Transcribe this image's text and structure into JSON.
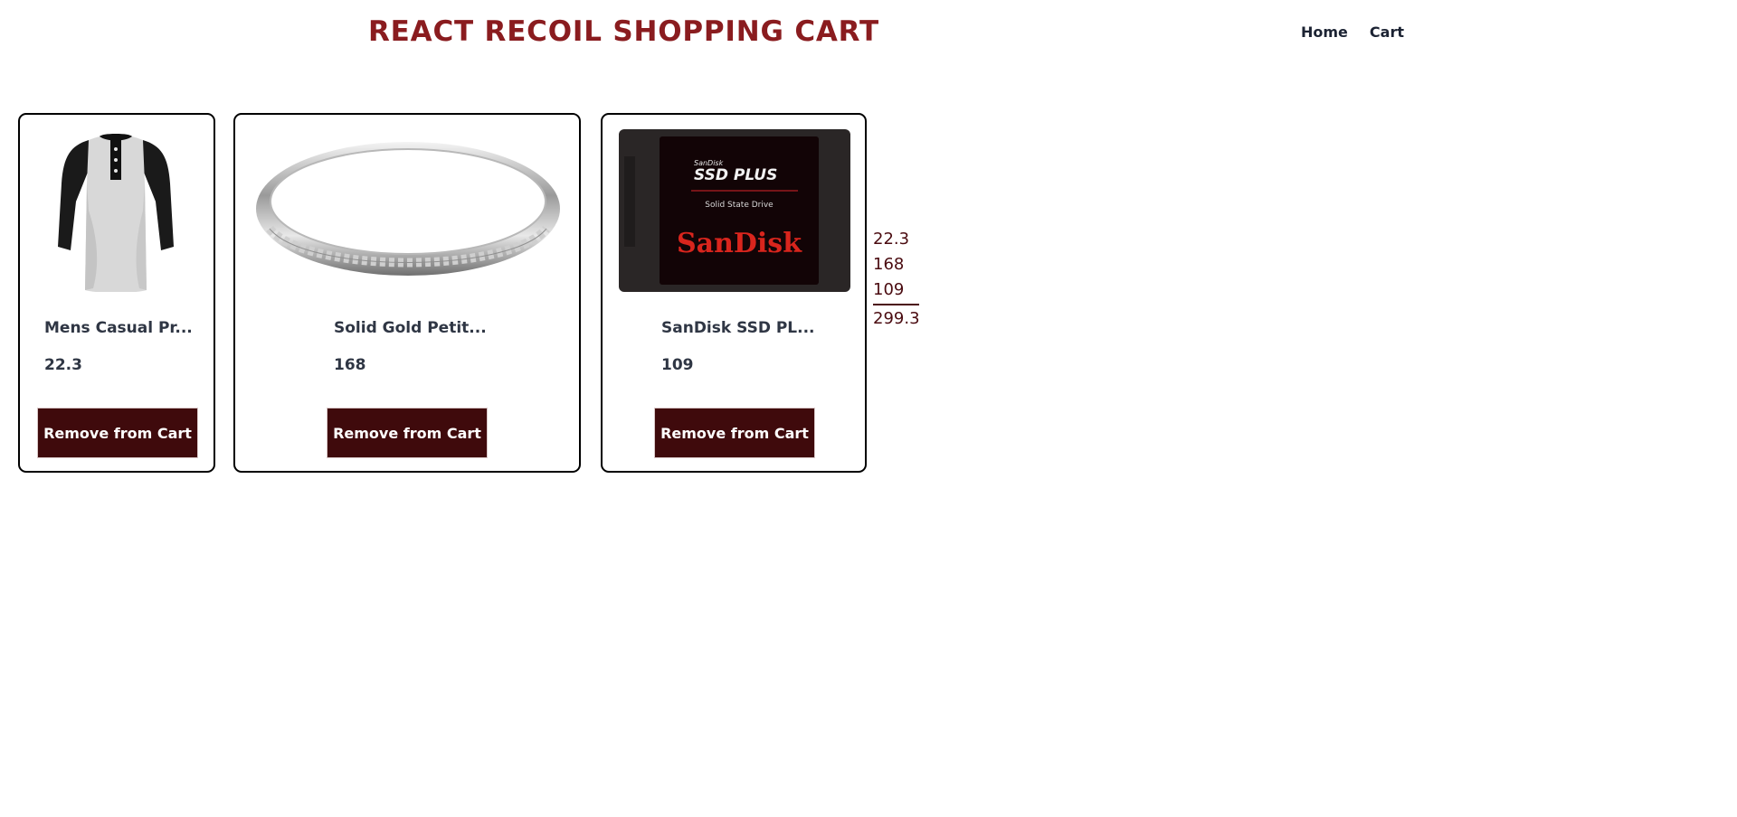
{
  "header": {
    "title": "REACT RECOIL SHOPPING CART",
    "nav": [
      "Home",
      "Cart"
    ]
  },
  "cart": {
    "items": [
      {
        "name": "Mens Casual Pr...",
        "price": "22.3",
        "button": "Remove from Cart",
        "image": "henley-shirt-image"
      },
      {
        "name": "Solid Gold Petit...",
        "price": "168",
        "button": "Remove from Cart",
        "image": "silver-ring-image"
      },
      {
        "name": "SanDisk SSD PL...",
        "price": "109",
        "button": "Remove from Cart",
        "image": "sandisk-ssd-image",
        "image_text": {
          "brand_small": "SanDisk",
          "product": "SSD PLUS",
          "subtitle": "Solid State Drive",
          "logo": "SanDisk"
        }
      }
    ]
  },
  "summary": {
    "prices": [
      "22.3",
      "168",
      "109"
    ],
    "total": "299.3"
  },
  "colors": {
    "title": "#8a1c1f",
    "button_bg": "#3f0a0c",
    "summary_text": "#4a0b10"
  }
}
